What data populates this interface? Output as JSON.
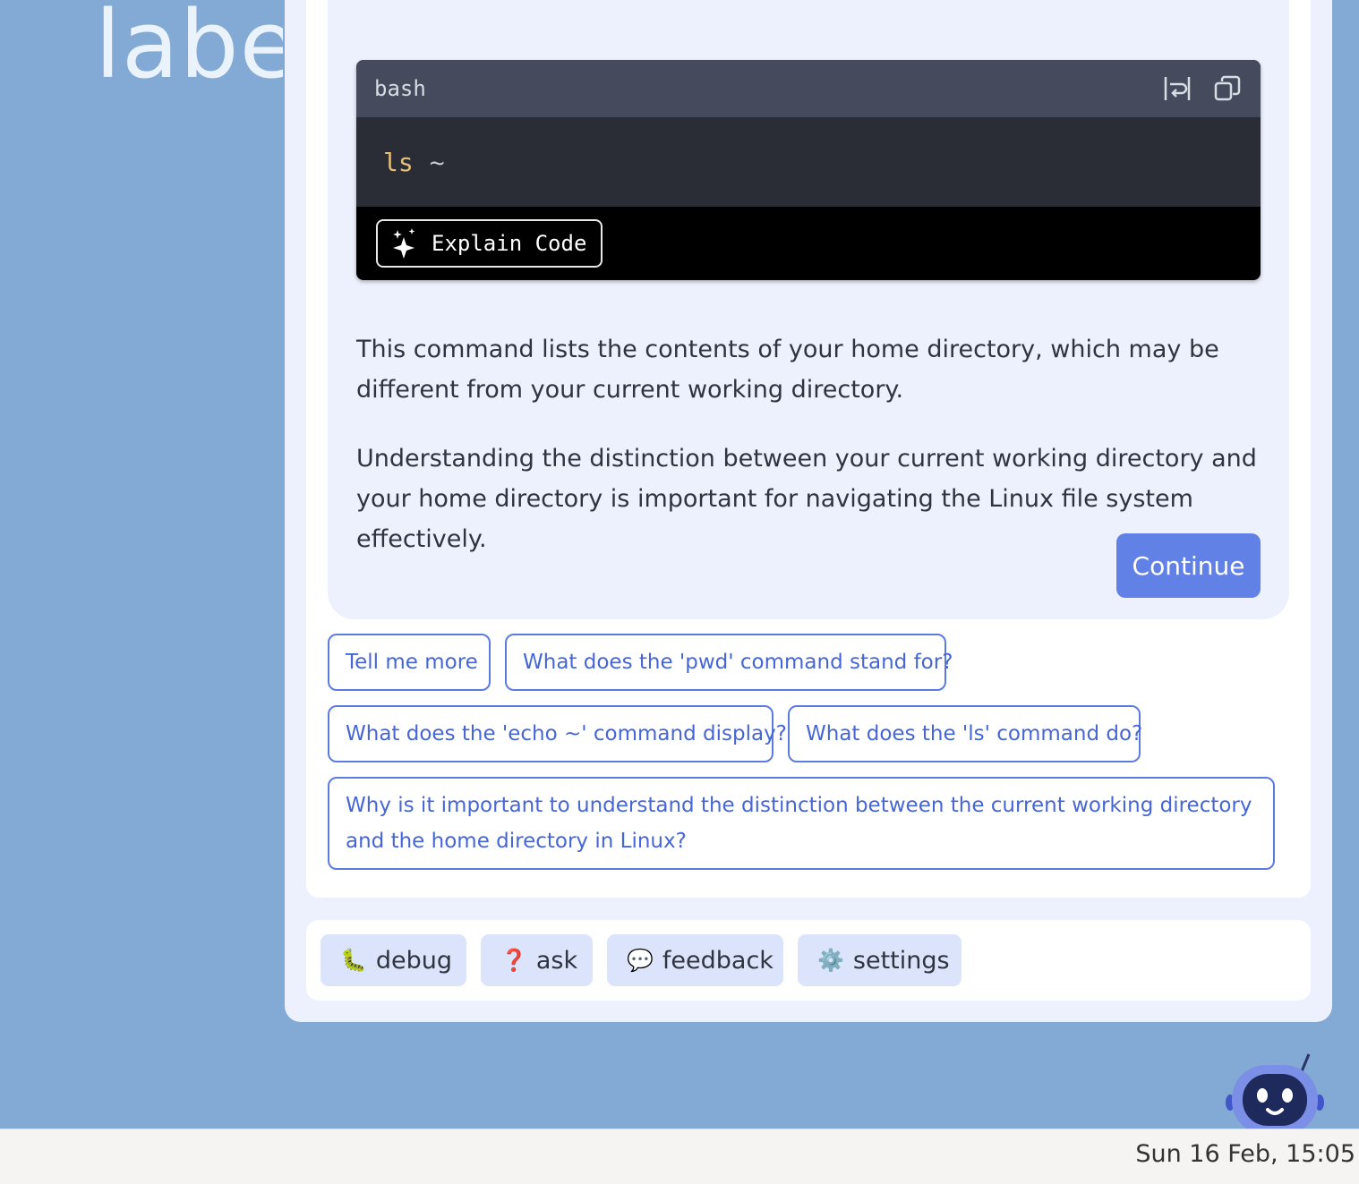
{
  "background": {
    "text": "labe"
  },
  "code_block": {
    "language": "bash",
    "command": "ls",
    "argument": "~",
    "wrap_icon": "wrap-icon",
    "copy_icon": "copy-icon",
    "explain_label": "Explain Code",
    "explain_icon": "sparkle-icon"
  },
  "message": {
    "paragraph1": "This command lists the contents of your home directory, which may be different from your current working directory.",
    "paragraph2": "Understanding the distinction between your current working directory and your home directory is important for navigating the Linux file system effectively.",
    "continue_label": "Continue"
  },
  "suggestions": [
    "Tell me more",
    "What does the 'pwd' command stand for?",
    "What does the 'echo ~' command display?",
    "What does the 'ls' command do?",
    "Why is it important to understand the distinction between the current working directory and the home directory in Linux?"
  ],
  "toolbar": {
    "debug": {
      "icon": "🐛",
      "label": "debug"
    },
    "ask": {
      "icon": "❓",
      "label": "ask"
    },
    "feedback": {
      "icon": "💬",
      "label": "feedback"
    },
    "settings": {
      "icon": "⚙️",
      "label": "settings"
    }
  },
  "taskbar": {
    "clock": "Sun 16 Feb, 15:05"
  },
  "colors": {
    "accent": "#6181e6",
    "chip_border": "#5b7be0",
    "background": "#82aad4"
  }
}
